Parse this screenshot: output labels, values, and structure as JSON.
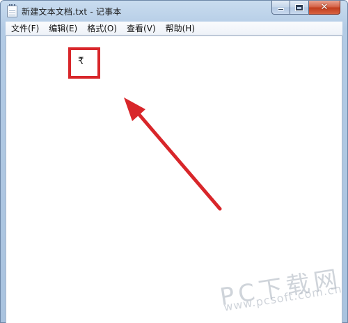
{
  "window": {
    "title": "新建文本文档.txt - 记事本"
  },
  "menu": {
    "items": [
      "文件(F)",
      "编辑(E)",
      "格式(O)",
      "查看(V)",
      "帮助(H)"
    ]
  },
  "editor": {
    "content": "₹"
  },
  "caption": {
    "minimize_icon": "minimize-icon",
    "maximize_icon": "maximize-icon",
    "close_icon": "close-icon",
    "close_glyph": "✕"
  },
  "watermark": {
    "main": "PC下载网",
    "sub": "www.pcsoft.com.cn"
  },
  "colors": {
    "highlight": "#d8262a",
    "arrow": "#d8262a"
  }
}
